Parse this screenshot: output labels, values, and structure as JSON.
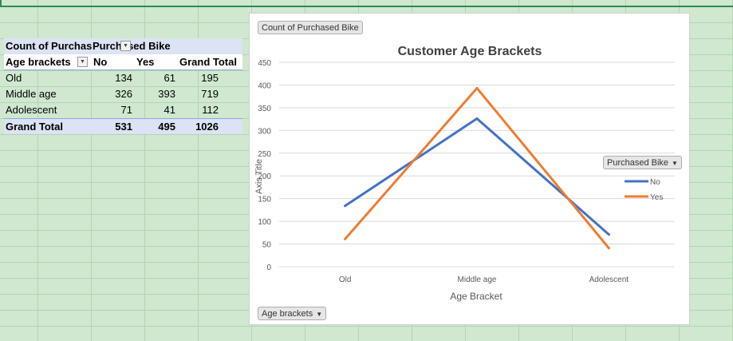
{
  "pivot": {
    "header1": {
      "values_label": "Count of Purchased Bike",
      "column_field": "Purchased Bike"
    },
    "header2": {
      "row_field": "Age brackets",
      "col_no": "No",
      "col_yes": "Yes",
      "col_total": "Grand Total"
    },
    "rows": [
      {
        "label": "Old",
        "no": "134",
        "yes": "61",
        "total": "195"
      },
      {
        "label": "Middle age",
        "no": "326",
        "yes": "393",
        "total": "719"
      },
      {
        "label": "Adolescent",
        "no": "71",
        "yes": "41",
        "total": "112"
      }
    ],
    "grand_total": {
      "label": "Grand Total",
      "no": "531",
      "yes": "495",
      "total": "1026"
    }
  },
  "chart_buttons": {
    "values_field": "Count of Purchased Bike",
    "legend_field": "Purchased Bike",
    "axis_field": "Age brackets"
  },
  "chart_data": {
    "type": "line",
    "title": "Customer Age Brackets",
    "xlabel": "Age Bracket",
    "ylabel": "Axis Title",
    "categories": [
      "Old",
      "Middle age",
      "Adolescent"
    ],
    "ylim": [
      0,
      450
    ],
    "yticks": [
      0,
      50,
      100,
      150,
      200,
      250,
      300,
      350,
      400,
      450
    ],
    "grid": true,
    "legend_position": "right",
    "series": [
      {
        "name": "No",
        "values": [
          134,
          326,
          71
        ],
        "color": "#4472c4"
      },
      {
        "name": "Yes",
        "values": [
          61,
          393,
          41
        ],
        "color": "#ed7d31"
      }
    ]
  }
}
